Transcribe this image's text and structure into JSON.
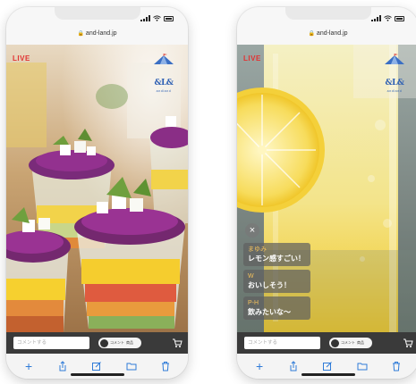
{
  "phones": [
    {
      "status_time": "",
      "url": "and-land.jp",
      "live_label": "LIVE",
      "logo_text": "&L&",
      "logo_sub": "andland",
      "chat_placeholder": "コメントする",
      "toggle_labels": [
        "コメント",
        "商品"
      ]
    },
    {
      "status_time": "",
      "url": "and-land.jp",
      "live_label": "LIVE",
      "logo_text": "&L&",
      "logo_sub": "andland",
      "close_label": "×",
      "comments": [
        {
          "name": "まゆみ",
          "text": "レモン感すごい！"
        },
        {
          "name": "W",
          "text": "おいしそう！"
        },
        {
          "name": "P-H",
          "text": "飲みたいな〜"
        }
      ],
      "chat_placeholder": "コメントする",
      "toggle_labels": [
        "コメント",
        "商品"
      ]
    }
  ],
  "colors": {
    "live": "#e23232",
    "logo": "#2d5fb3",
    "toolbar_icon": "#2f7bd8",
    "commenter_name": "#f4c25c"
  },
  "toolbar_icons": [
    "plus-icon",
    "share-icon",
    "compose-icon",
    "folder-icon",
    "trash-icon"
  ]
}
